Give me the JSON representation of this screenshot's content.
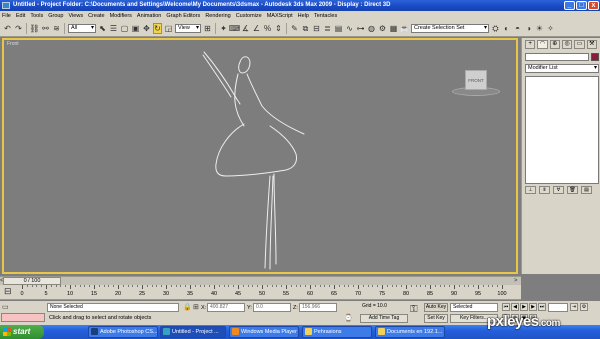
{
  "title_bar": {
    "text": "Untitled    - Project Folder: C:\\Documents and Settings\\Welcome\\My Documents\\3dsmax    - Autodesk 3ds Max  2009         - Display : Direct 3D",
    "buttons": [
      "_",
      "□",
      "x"
    ]
  },
  "menu": [
    "File",
    "Edit",
    "Tools",
    "Group",
    "Views",
    "Create",
    "Modifiers",
    "Animation",
    "Graph Editors",
    "Rendering",
    "Customize",
    "MAXScript",
    "Help",
    "Tentacles"
  ],
  "toolbar": {
    "filter_select": "All",
    "coord_select": "View",
    "selection_set": "Create Selection Set"
  },
  "viewport": {
    "label": "Front",
    "viewcube_label": "FRONT"
  },
  "command_panel": {
    "tabs": [
      "+",
      "◠",
      "⊕",
      "◎",
      "▭",
      "⚒"
    ],
    "modifier_list": "Modifier List",
    "object_color": "#8a1c3b"
  },
  "time_slider": {
    "value": "0 / 100",
    "prev": "<",
    "next": ">"
  },
  "track_bar": {
    "ticks": [
      "0",
      "5",
      "10",
      "15",
      "20",
      "25",
      "30",
      "35",
      "40",
      "45",
      "50",
      "55",
      "60",
      "65",
      "70",
      "75",
      "80",
      "85",
      "90",
      "95",
      "100"
    ]
  },
  "status": {
    "selection": "None Selected",
    "prompt": "Click and drag to select and rotate objects",
    "x_label": "X:",
    "x_value": "400.827",
    "y_label": "Y:",
    "y_value": "0.0",
    "z_label": "Z:",
    "z_value": "156.966",
    "grid": "Grid = 10.0",
    "add_time_tag": "Add Time Tag",
    "auto_key": "Auto Key",
    "set_key": "Set Key",
    "key_mode": "Selected",
    "key_filters": "Key Filters..."
  },
  "taskbar": {
    "start": "start",
    "tasks": [
      "Adobe Photoshop CS...",
      "Untitled   - Project ...",
      "Windows Media Player",
      "Pehrasions",
      "Documents en 192.1..."
    ]
  },
  "watermark": {
    "name": "pxleyes",
    "suffix": ".com"
  }
}
